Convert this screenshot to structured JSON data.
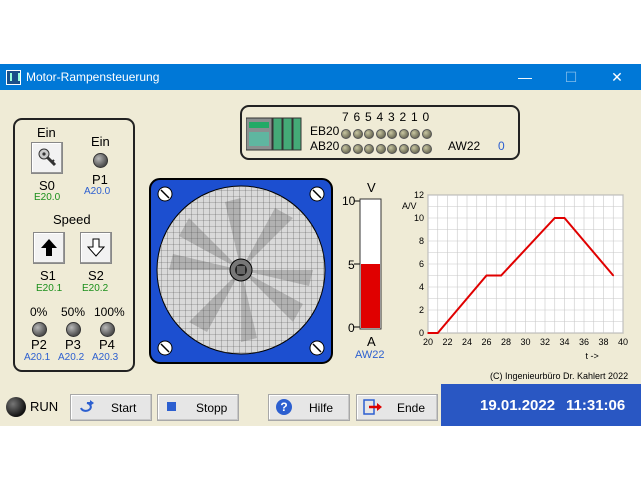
{
  "window": {
    "title": "Motor-Rampensteuerung",
    "minimize": "—",
    "maximize": "☐",
    "close": "✕"
  },
  "left_panel": {
    "s0_top": "Ein",
    "p1_top": "Ein",
    "s0_label": "S0",
    "s0_addr": "E20.0",
    "p1_label": "P1",
    "p1_addr": "A20.0",
    "speed_label": "Speed",
    "s1_label": "S1",
    "s1_addr": "E20.1",
    "s2_label": "S2",
    "s2_addr": "E20.2",
    "pct_0": "0%",
    "pct_50": "50%",
    "pct_100": "100%",
    "p2_label": "P2",
    "p2_addr": "A20.1",
    "p3_label": "P3",
    "p3_addr": "A20.2",
    "p4_label": "P4",
    "p4_addr": "A20.3"
  },
  "io_panel": {
    "bits": [
      "7",
      "6",
      "5",
      "4",
      "3",
      "2",
      "1",
      "0"
    ],
    "eb_label": "EB20",
    "ab_label": "AB20",
    "aw_label": "AW22",
    "aw_value": "0"
  },
  "gauge": {
    "unit_top": "V",
    "t10": "10",
    "t5": "5",
    "t0": "0",
    "unit_bottom": "A",
    "addr": "AW22",
    "level": 0.5,
    "fill_color": "#e00000"
  },
  "chart_data": {
    "type": "line",
    "ylabel": "A/V",
    "xlabel": "t ->",
    "xlim": [
      20,
      40
    ],
    "ylim": [
      0,
      12
    ],
    "xticks": [
      "20",
      "22",
      "24",
      "26",
      "28",
      "30",
      "32",
      "34",
      "36",
      "38",
      "40"
    ],
    "yticks": [
      "0",
      "2",
      "4",
      "6",
      "8",
      "10",
      "12"
    ],
    "grid": true,
    "series": [
      {
        "color": "#e00000",
        "x": [
          20,
          21,
          26,
          27.5,
          33,
          34,
          39
        ],
        "y": [
          0,
          0,
          5,
          5,
          10,
          10,
          5
        ]
      }
    ]
  },
  "copyright": "(C) Ingenieurbüro Dr. Kahlert 2022",
  "toolbar": {
    "run_label": "RUN",
    "start_label": "Start",
    "stop_label": "Stopp",
    "help_label": "Hilfe",
    "end_label": "Ende"
  },
  "clock": {
    "date": "19.01.2022",
    "time": "11:31:06"
  }
}
